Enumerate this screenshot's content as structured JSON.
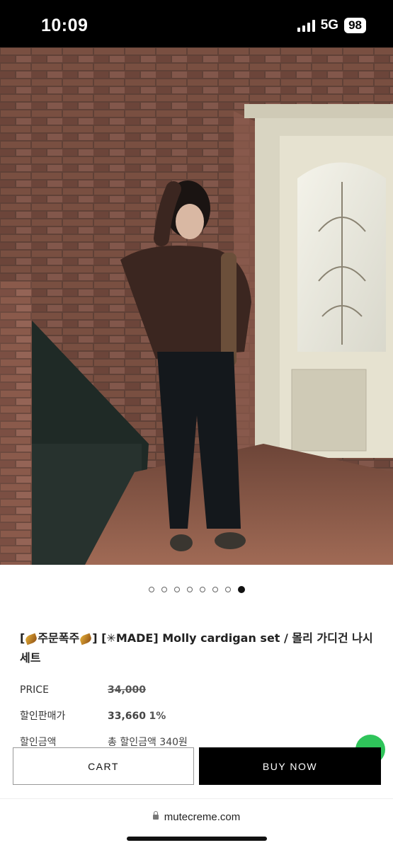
{
  "status_bar": {
    "time": "10:09",
    "network": "5G",
    "battery": "98"
  },
  "carousel": {
    "total": 8,
    "active_index": 7
  },
  "product": {
    "title_tag": "주문폭주",
    "title_main": "[✳︎MADE] Molly cardigan set / 몰리 가디건 나시 세트"
  },
  "prices": {
    "price_label": "PRICE",
    "price_value": "34,000",
    "discount_label": "할인판매가",
    "discount_value": "33,660",
    "discount_rate": "1%",
    "partial_label": "할인금액",
    "partial_value": "총 할인금액 340원"
  },
  "actions": {
    "cart": "CART",
    "buy_now": "BUY NOW"
  },
  "browser": {
    "url": "mutecreme.com"
  }
}
